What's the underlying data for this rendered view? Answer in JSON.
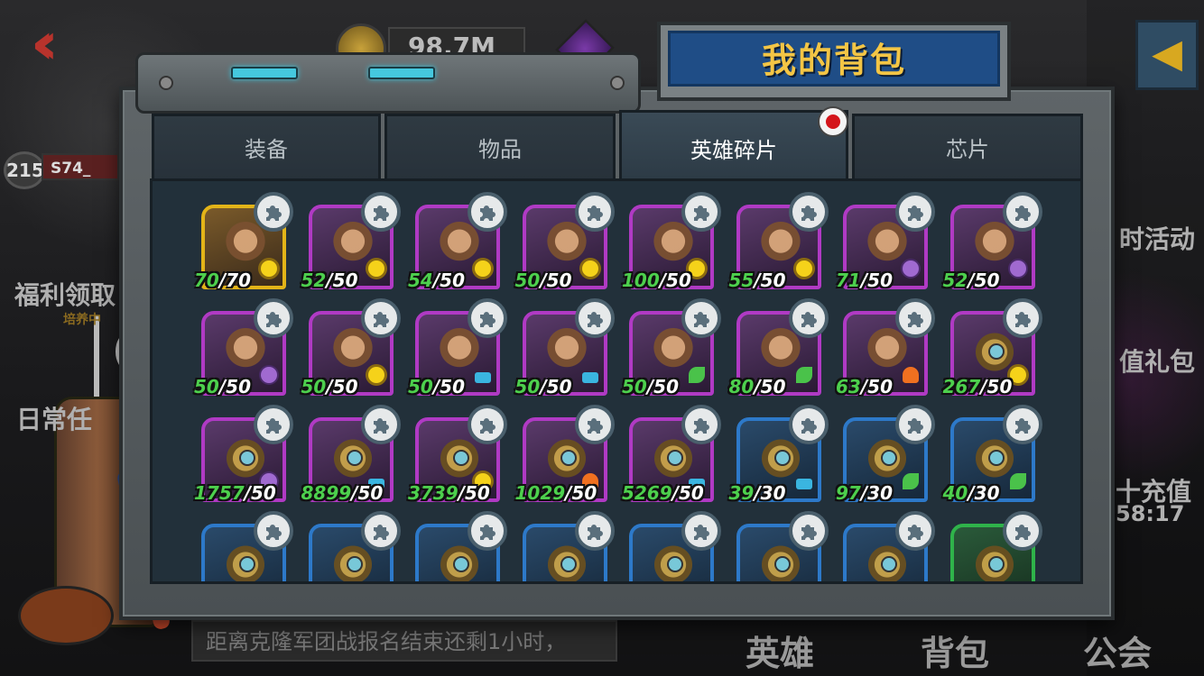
{
  "background": {
    "level": "215",
    "server": "S74_",
    "gold": "98.7M",
    "left_labels": [
      "福利领取",
      "日常任"
    ],
    "left_sub": "培养中",
    "right_labels": [
      "时活动",
      "值礼包",
      "十充值"
    ],
    "right_timer": "58:17",
    "notice": "距离克隆军团战报名结束还剩1小时，",
    "bottom_tabs": [
      "英雄",
      "背包",
      "公会"
    ]
  },
  "dialog": {
    "title": "我的背包",
    "tabs": [
      {
        "label": "装备",
        "active": false
      },
      {
        "label": "物品",
        "active": false
      },
      {
        "label": "英雄碎片",
        "active": true,
        "notification": true
      },
      {
        "label": "芯片",
        "active": false
      }
    ]
  },
  "fragments": [
    {
      "rarity": "gold",
      "element": "sun",
      "owned": "70",
      "required": "70"
    },
    {
      "rarity": "purple",
      "element": "sun",
      "owned": "52",
      "required": "50"
    },
    {
      "rarity": "purple",
      "element": "sun",
      "owned": "54",
      "required": "50"
    },
    {
      "rarity": "purple",
      "element": "sun",
      "owned": "50",
      "required": "50"
    },
    {
      "rarity": "purple",
      "element": "sun",
      "owned": "100",
      "required": "50"
    },
    {
      "rarity": "purple",
      "element": "sun",
      "owned": "55",
      "required": "50"
    },
    {
      "rarity": "purple",
      "element": "swirl",
      "owned": "71",
      "required": "50"
    },
    {
      "rarity": "purple",
      "element": "swirl",
      "owned": "52",
      "required": "50"
    },
    {
      "rarity": "purple",
      "element": "swirl",
      "owned": "50",
      "required": "50"
    },
    {
      "rarity": "purple",
      "element": "sun",
      "owned": "50",
      "required": "50"
    },
    {
      "rarity": "purple",
      "element": "wave",
      "owned": "50",
      "required": "50"
    },
    {
      "rarity": "purple",
      "element": "wave",
      "owned": "50",
      "required": "50"
    },
    {
      "rarity": "purple",
      "element": "leaf",
      "owned": "50",
      "required": "50"
    },
    {
      "rarity": "purple",
      "element": "leaf",
      "owned": "80",
      "required": "50"
    },
    {
      "rarity": "purple",
      "element": "fire",
      "owned": "63",
      "required": "50"
    },
    {
      "rarity": "purple",
      "element": "sun",
      "owned": "267",
      "required": "50"
    },
    {
      "rarity": "purple",
      "element": "swirl",
      "owned": "1757",
      "required": "50"
    },
    {
      "rarity": "purple",
      "element": "wave",
      "owned": "8899",
      "required": "50"
    },
    {
      "rarity": "purple",
      "element": "sun",
      "owned": "3739",
      "required": "50"
    },
    {
      "rarity": "purple",
      "element": "fire",
      "owned": "1029",
      "required": "50"
    },
    {
      "rarity": "purple",
      "element": "wave",
      "owned": "5269",
      "required": "50"
    },
    {
      "rarity": "blue",
      "element": "wave",
      "owned": "39",
      "required": "30"
    },
    {
      "rarity": "blue",
      "element": "leaf",
      "owned": "97",
      "required": "30"
    },
    {
      "rarity": "blue",
      "element": "leaf",
      "owned": "40",
      "required": "30"
    },
    {
      "rarity": "blue",
      "element": "none",
      "owned": "",
      "required": ""
    },
    {
      "rarity": "blue",
      "element": "none",
      "owned": "",
      "required": ""
    },
    {
      "rarity": "blue",
      "element": "none",
      "owned": "",
      "required": ""
    },
    {
      "rarity": "blue",
      "element": "none",
      "owned": "",
      "required": ""
    },
    {
      "rarity": "blue",
      "element": "none",
      "owned": "",
      "required": ""
    },
    {
      "rarity": "blue",
      "element": "none",
      "owned": "",
      "required": ""
    },
    {
      "rarity": "blue",
      "element": "none",
      "owned": "",
      "required": ""
    },
    {
      "rarity": "green",
      "element": "none",
      "owned": "",
      "required": ""
    }
  ],
  "colors": {
    "title_text": "#f3c545",
    "title_plate": "#1f4d86",
    "owned_count": "#4dd04d",
    "purple_frame": "#b03ac4",
    "gold_frame": "#e3b418",
    "blue_frame": "#2d79c9",
    "green_frame": "#2fb34a",
    "notification_dot": "#d4151b"
  }
}
